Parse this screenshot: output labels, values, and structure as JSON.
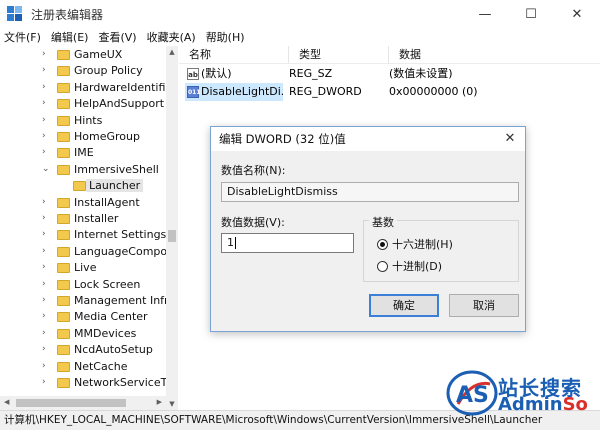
{
  "window": {
    "title": "注册表编辑器",
    "minimize": "—",
    "maximize": "☐",
    "close": "✕"
  },
  "menu": [
    "文件(F)",
    "编辑(E)",
    "查看(V)",
    "收藏夹(A)",
    "帮助(H)"
  ],
  "tree": {
    "items": [
      {
        "label": "GameUX",
        "expandable": true
      },
      {
        "label": "Group Policy",
        "expandable": true
      },
      {
        "label": "HardwareIdentifica",
        "expandable": true
      },
      {
        "label": "HelpAndSupport",
        "expandable": true
      },
      {
        "label": "Hints",
        "expandable": true
      },
      {
        "label": "HomeGroup",
        "expandable": true
      },
      {
        "label": "IME",
        "expandable": true
      },
      {
        "label": "ImmersiveShell",
        "expandable": true,
        "expanded": true
      },
      {
        "label": "Launcher",
        "child": true,
        "selected": true
      },
      {
        "label": "InstallAgent",
        "expandable": true
      },
      {
        "label": "Installer",
        "expandable": true
      },
      {
        "label": "Internet Settings",
        "expandable": true
      },
      {
        "label": "LanguageCompone",
        "expandable": true
      },
      {
        "label": "Live",
        "expandable": true
      },
      {
        "label": "Lock Screen",
        "expandable": true
      },
      {
        "label": "Management Infra",
        "expandable": true
      },
      {
        "label": "Media Center",
        "expandable": true
      },
      {
        "label": "MMDevices",
        "expandable": true
      },
      {
        "label": "NcdAutoSetup",
        "expandable": true
      },
      {
        "label": "NetCache",
        "expandable": true
      },
      {
        "label": "NetworkServiceTrig",
        "expandable": true
      }
    ]
  },
  "list": {
    "columns": [
      "名称",
      "类型",
      "数据"
    ],
    "rows": [
      {
        "name": "(默认)",
        "type": "REG_SZ",
        "data": "(数值未设置)",
        "icon": "string-value-icon",
        "icon_text": "ab"
      },
      {
        "name": "DisableLightDi...",
        "type": "REG_DWORD",
        "data": "0x00000000 (0)",
        "icon": "binary-value-icon",
        "icon_text": "011",
        "selected": true
      }
    ]
  },
  "status": {
    "path": "计算机\\HKEY_LOCAL_MACHINE\\SOFTWARE\\Microsoft\\Windows\\CurrentVersion\\ImmersiveShell\\Launcher"
  },
  "dialog": {
    "title": "编辑 DWORD (32 位)值",
    "close": "✕",
    "name_label": "数值名称(N):",
    "name_value": "DisableLightDismiss",
    "data_label": "数值数据(V):",
    "data_value": "1",
    "base_label": "基数",
    "hex_label": "十六进制(H)",
    "dec_label": "十进制(D)",
    "selected_base": "hex",
    "ok_label": "确定",
    "cancel_label": "取消"
  },
  "watermark": {
    "cn": "站长搜索",
    "en_a": "Admin",
    "en_b": "So",
    "logo": "AS"
  },
  "colors": {
    "accent": "#3c7fd8",
    "selected_row": "#cce8ff",
    "folder": "#f2c94c"
  }
}
